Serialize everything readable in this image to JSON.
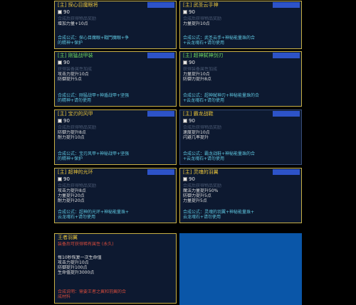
{
  "colors": {
    "title_gold": "#e8c33a",
    "title_green": "#6cd45e",
    "recipe_cyan": "#5fc7e0",
    "badge_blue": "#2d53c8",
    "empty_slot": "#0a56a8"
  },
  "cards": [
    {
      "title": "[主] 探心目魔眼将",
      "title_color": "#e8c33a",
      "badge": "",
      "level": "90",
      "icon": "item-icon",
      "lines": [
        "合成后获得物品奖励",
        "增加力量+10点"
      ],
      "recipe": [
        "合成公式：探心目魔眼+戰鬥魔眼+争",
        "的精神+保护"
      ]
    },
    {
      "title": "[主] 武圣云手神",
      "title_color": "#e8c33a",
      "badge": "",
      "level": "90",
      "icon": "item-icon",
      "lines": [
        "合成后获得物品奖励",
        "力量提升10点"
      ],
      "recipe": [
        "合成公式：武圣云手+神秘能量珠的合",
        "+云龙魂石+请勿使用"
      ]
    },
    {
      "title": "[主] 刚猛战甲装",
      "title_color": "#6cd45e",
      "badge": "",
      "level": "90",
      "icon": "item-icon",
      "lines": [
        "获得装备属性加成",
        "攻击力提升10点",
        "防御提升5点"
      ],
      "recipe": [
        "合成公式：刚猛战甲+神盾战甲+坚强",
        "的精神+请勿使用"
      ]
    },
    {
      "title": "[主] 超神弑神剑刃",
      "title_color": "#6cd45e",
      "badge": "",
      "level": "90",
      "icon": "item-icon",
      "lines": [
        "获得装备属性加成",
        "力量提升10点",
        "防御力提升8点"
      ],
      "recipe": [
        "合成公式：超神弑神刃+神秘能量珠的合",
        "+云龙魂石+请勿使用"
      ]
    },
    {
      "title": "[主] 宝刃的风甲",
      "title_color": "#e8c33a",
      "badge": "",
      "level": "90",
      "icon": "item-icon",
      "lines": [
        "合成后获得物品奖励",
        "防御力提升8点",
        "耐力提升10点"
      ],
      "recipe": [
        "合成公式：宝刃风甲+神秘战甲+坚强",
        "的精神+保护"
      ]
    },
    {
      "title": "[主] 霸龙战鞋",
      "title_color": "#e8c33a",
      "badge": "",
      "level": "90",
      "icon": "item-icon",
      "lines": [
        "合成后获得物品奖励",
        "速度提升10点",
        "闪避几率提升"
      ],
      "recipe": [
        "合成公式：霸龙战鞋+神秘能量珠的合",
        "+云龙魂石+请勿使用"
      ]
    },
    {
      "title": "[主] 超神的光环",
      "title_color": "#e8c33a",
      "badge": "",
      "level": "90",
      "icon": "item-icon",
      "lines": [
        "合成后获得物品奖励",
        "攻击力提升8点",
        "力量提升20点",
        "耐力提升20点"
      ],
      "recipe": [
        "合成公式：超神的光环+神秘能量珠+",
        "云龙魂石+请勿使用"
      ]
    },
    {
      "title": "[主] 灵魂的羽翼",
      "title_color": "#e8c33a",
      "badge": "",
      "level": "90",
      "icon": "item-icon",
      "lines": [
        "合成后获得物品奖励",
        "魔法力量提升50%",
        "防御力提升5点",
        "力量提升5点"
      ],
      "recipe": [
        "合成公式：灵魂的羽翼+神秘能量珠+",
        "云龙魂石+请勿使用"
      ]
    }
  ],
  "special": {
    "title": "王者羽翼",
    "subtitle": "装备后可获得稀有属性 (永久)",
    "lines": [
      "每10秒恢复一次生命值",
      "攻击力提升10点",
      "防御提升100点",
      "生命值提升3000点"
    ],
    "note": [
      "合成说明：需要王者之翼和羽翼的合",
      "成材料"
    ]
  }
}
